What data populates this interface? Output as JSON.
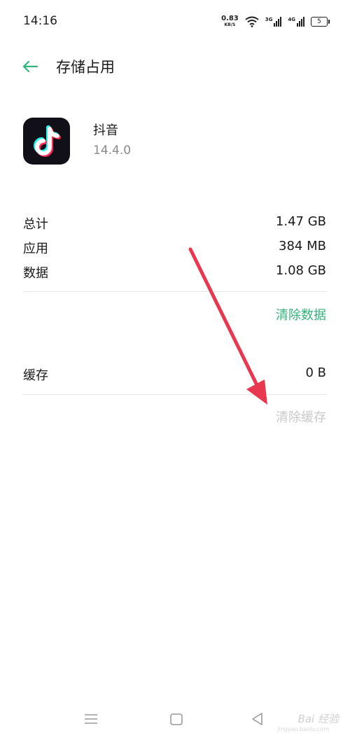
{
  "status_bar": {
    "time": "14:16",
    "net_speed_value": "0.83",
    "net_speed_unit": "KB/S",
    "sim1_tag": "3G",
    "sim2_tag": "4G",
    "battery": "5"
  },
  "header": {
    "title": "存储占用"
  },
  "app": {
    "name": "抖音",
    "version": "14.4.0"
  },
  "storage": {
    "rows": [
      {
        "label": "总计",
        "value": "1.47 GB"
      },
      {
        "label": "应用",
        "value": "384 MB"
      },
      {
        "label": "数据",
        "value": "1.08 GB"
      }
    ],
    "clear_data_label": "清除数据",
    "cache_label": "缓存",
    "cache_value": "0 B",
    "clear_cache_label": "清除缓存"
  },
  "colors": {
    "accent_green": "#33b27a",
    "annotation_arrow": "#e8384f",
    "disabled_text": "#c9c9c9"
  },
  "watermark": {
    "text": "Bai 经验",
    "sub": "jingyan.baidu.com"
  },
  "nav": {
    "icons": [
      "menu-icon",
      "home-icon",
      "back-icon"
    ]
  }
}
